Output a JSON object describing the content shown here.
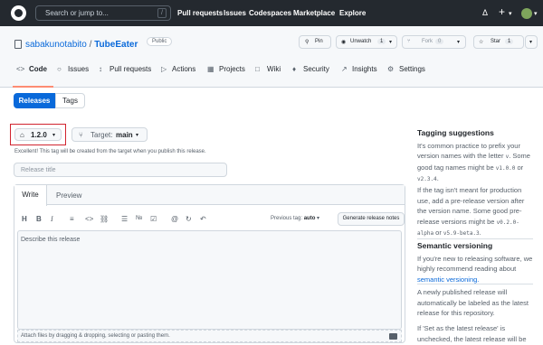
{
  "topnav": {
    "search_placeholder": "Search or jump to...",
    "slash": "/",
    "links": [
      "Pull requests",
      "Issues",
      "Codespaces",
      "Marketplace",
      "Explore"
    ],
    "bell": "Δ",
    "plus": "+",
    "caret": "▾"
  },
  "repo": {
    "owner": "sabakunotabito",
    "sep": "/",
    "name": "TubeEater",
    "visibility": "Public",
    "pin": "Pin",
    "unwatch": "Unwatch",
    "watch_count": "1",
    "fork": "Fork",
    "fork_count": "0",
    "star": "Star",
    "star_count": "1"
  },
  "tabs": [
    "Code",
    "Issues",
    "Pull requests",
    "Actions",
    "Projects",
    "Wiki",
    "Security",
    "Insights",
    "Settings"
  ],
  "tab_icons": [
    "<>",
    "○",
    "↕",
    "▷",
    "▦",
    "□",
    "♦",
    "↗",
    "⚙"
  ],
  "segment": {
    "releases": "Releases",
    "tags": "Tags"
  },
  "release": {
    "tag": "1.2.0",
    "target_label": "Target:",
    "target_value": "main",
    "note": "Excellent! This tag will be created from the target when you publish this release.",
    "title_placeholder": "Release title",
    "write": "Write",
    "preview": "Preview",
    "toolbar": [
      "H",
      "B",
      "I",
      "≡",
      "<>",
      "⛓",
      "☰",
      "№",
      "☑",
      "@",
      "↻",
      "↶"
    ],
    "previous_tag_label": "Previous tag:",
    "previous_tag_value": "auto",
    "generate": "Generate release notes",
    "body_placeholder": "Describe this release",
    "attach": "Attach files by dragging & dropping, selecting or pasting them."
  },
  "sidebar": {
    "tagging_title": "Tagging suggestions",
    "tagging_p1_a": "It's common practice to prefix your version names with the letter",
    "tagging_code_v": "v",
    "tagging_p1_b": ". Some good tag names might be",
    "tagging_code_1": "v1.0.0",
    "tagging_or": "or",
    "tagging_code_2": "v2.3.4",
    "tagging_p2_a": "If the tag isn't meant for production use, add a pre-release version after the version name. Some good pre-release versions might be",
    "tagging_code_3": "v0.2.0-alpha",
    "tagging_code_4": "v5.9-beta.3",
    "semver_title": "Semantic versioning",
    "semver_p1": "If you're new to releasing software, we highly recommend reading about",
    "semver_link": "semantic versioning.",
    "latest_p": "A newly published release will automatically be labeled as the latest release for this repository.",
    "latest_p2": "If 'Set as the latest release' is unchecked, the latest release will be"
  }
}
